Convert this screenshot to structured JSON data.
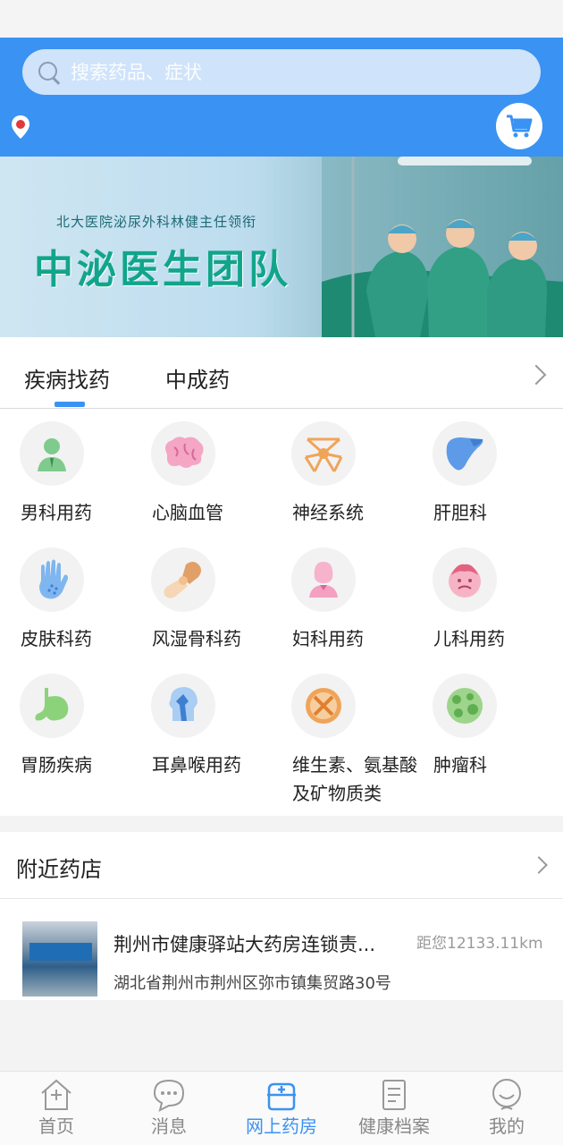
{
  "search": {
    "placeholder": "搜索药品、症状"
  },
  "icons": {
    "location": "location-pin-icon",
    "cart": "shopping-cart-icon",
    "search": "search-icon"
  },
  "banner": {
    "subtitle": "北大医院泌尿外科林健主任领衔",
    "title": "中泌医生团队"
  },
  "tabs": [
    {
      "label": "疾病找药",
      "active": true
    },
    {
      "label": "中成药",
      "active": false
    }
  ],
  "categories": [
    {
      "label": "男科用药",
      "icon": "male-figure-icon"
    },
    {
      "label": "心脑血管",
      "icon": "brain-icon"
    },
    {
      "label": "神经系统",
      "icon": "neuron-icon"
    },
    {
      "label": "肝胆科",
      "icon": "liver-icon"
    },
    {
      "label": "皮肤科药",
      "icon": "hand-skin-icon"
    },
    {
      "label": "风湿骨科药",
      "icon": "bone-joint-icon"
    },
    {
      "label": "妇科用药",
      "icon": "female-figure-icon"
    },
    {
      "label": "儿科用药",
      "icon": "child-face-icon"
    },
    {
      "label": "胃肠疾病",
      "icon": "stomach-icon"
    },
    {
      "label": "耳鼻喉用药",
      "icon": "ent-head-icon"
    },
    {
      "label": "维生素、氨基酸及矿物质类",
      "icon": "vitamin-icon"
    },
    {
      "label": "肿瘤科",
      "icon": "tumor-cells-icon"
    }
  ],
  "nearby": {
    "title": "附近药店",
    "store": {
      "name": "荆州市健康驿站大药房连锁责...",
      "distance": "距您12133.11km",
      "address": "湖北省荆州市荆州区弥市镇集贸路30号"
    }
  },
  "bottom_nav": [
    {
      "label": "首页",
      "icon": "home-icon",
      "active": false
    },
    {
      "label": "消息",
      "icon": "message-icon",
      "active": false
    },
    {
      "label": "网上药房",
      "icon": "pharmacy-icon",
      "active": true
    },
    {
      "label": "健康档案",
      "icon": "document-icon",
      "active": false
    },
    {
      "label": "我的",
      "icon": "profile-icon",
      "active": false
    }
  ],
  "colors": {
    "primary": "#3a92f3",
    "background": "#f3f3f3"
  }
}
